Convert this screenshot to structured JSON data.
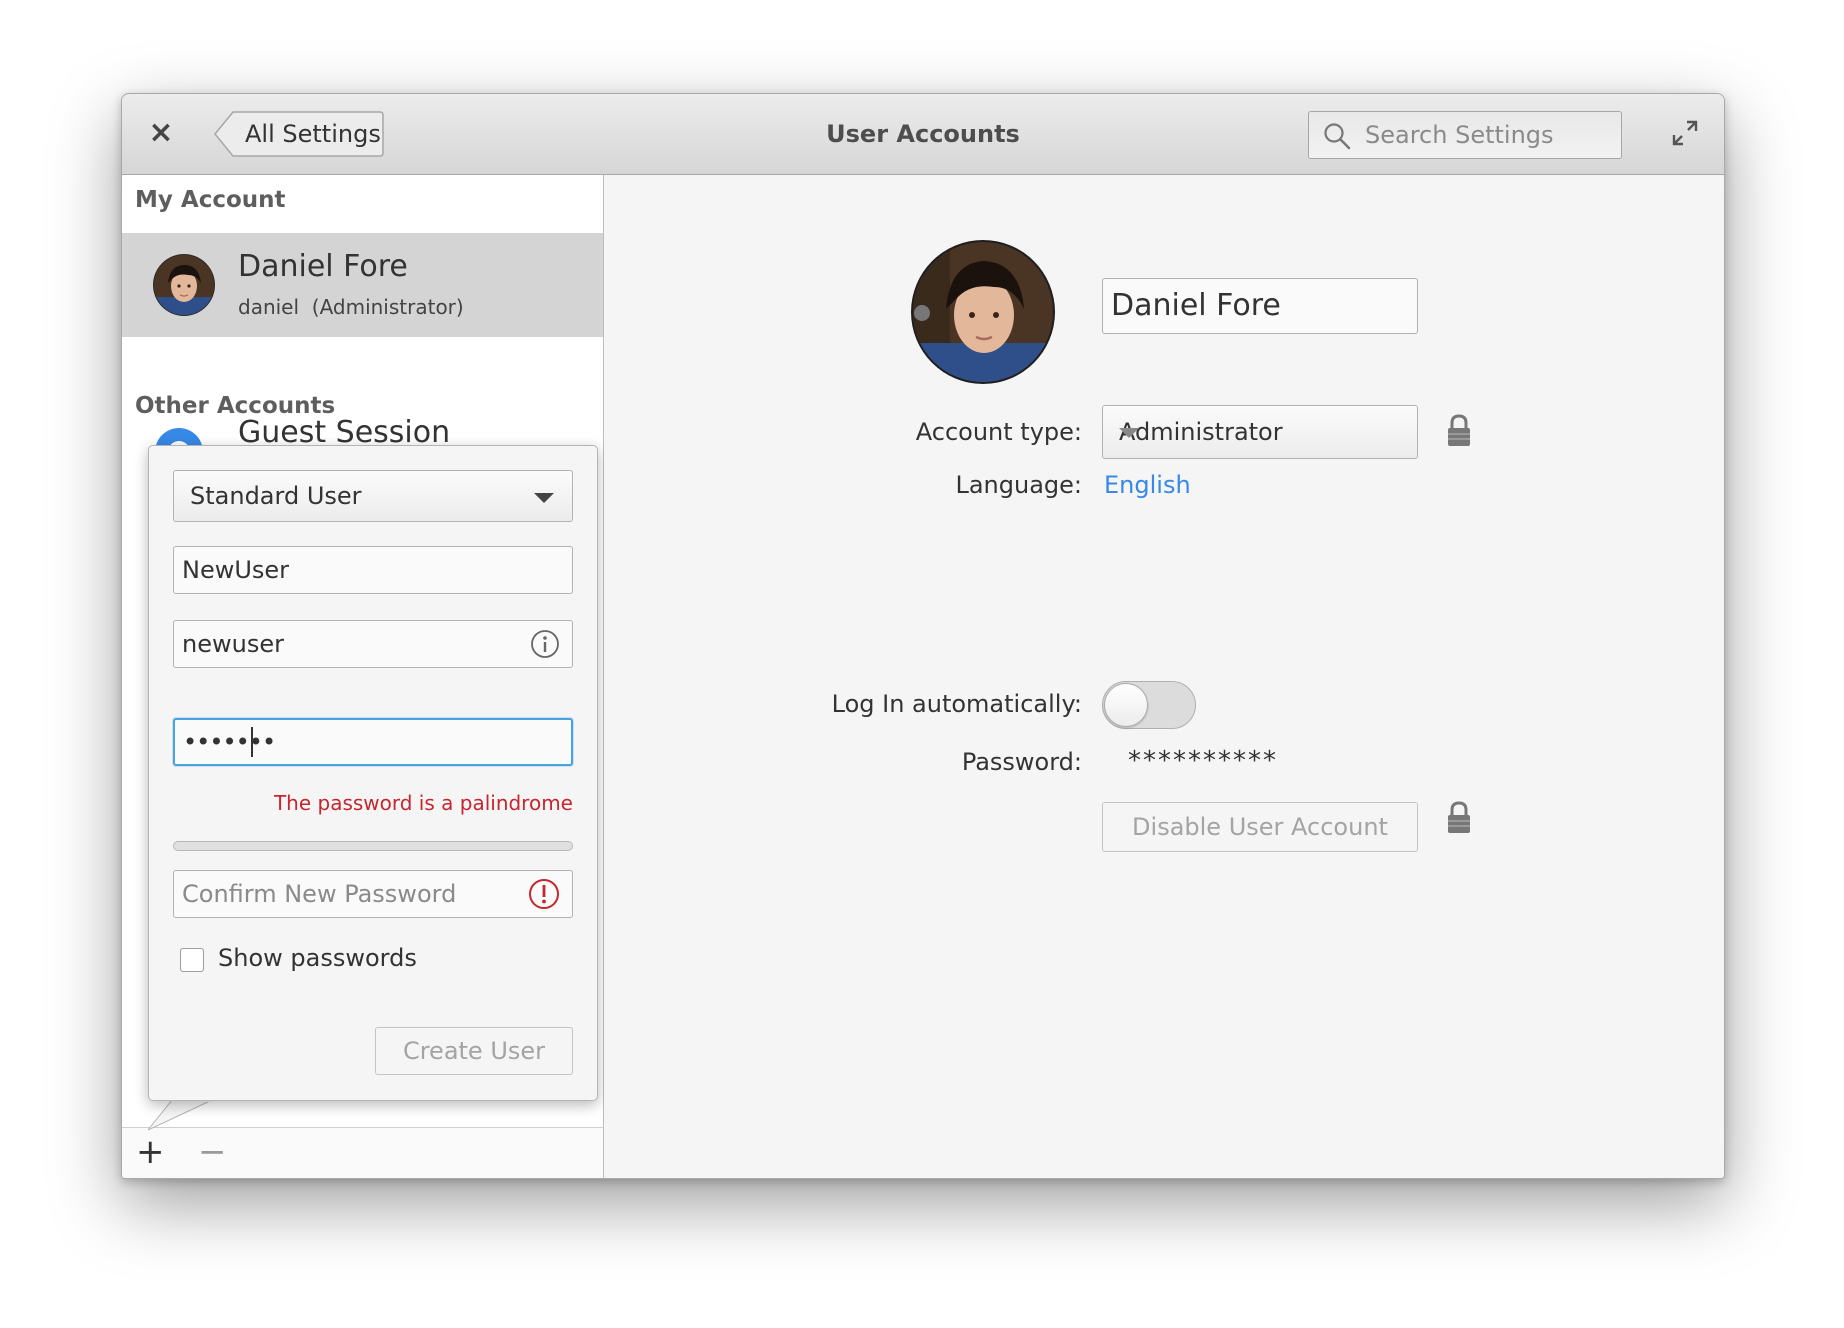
{
  "window": {
    "title": "User Accounts",
    "back_label": "All Settings",
    "search_placeholder": "Search Settings"
  },
  "sidebar": {
    "my_account_header": "My Account",
    "my_account": {
      "name": "Daniel Fore",
      "username": "daniel",
      "role": "(Administrator)"
    },
    "other_accounts_header": "Other Accounts",
    "guest": {
      "name": "Guest Session"
    },
    "footer": {
      "add_label": "+",
      "remove_label": "−"
    }
  },
  "new_user_popover": {
    "account_type": "Standard User",
    "full_name": "NewUser",
    "username": "newuser",
    "password_masked": "•••••••",
    "password_error": "The password is a palindrome",
    "password_strength": 0,
    "confirm_placeholder": "Confirm New Password",
    "show_passwords_label": "Show passwords",
    "show_passwords_checked": false,
    "create_label": "Create User"
  },
  "user_details": {
    "full_name": "Daniel Fore",
    "account_type_label": "Account type:",
    "account_type_value": "Administrator",
    "language_label": "Language:",
    "language_value": "English",
    "autologin_label": "Log In automatically:",
    "autologin_on": false,
    "password_label": "Password:",
    "password_value": "**********",
    "disable_label": "Disable User Account"
  },
  "colors": {
    "accent": "#3689e6",
    "error": "#c6262e",
    "focus": "#4aa3df",
    "guest_icon": "#3689e6"
  },
  "icons": {
    "close": "close-icon",
    "search": "search-icon",
    "maximize": "maximize-icon",
    "info": "info-icon",
    "error": "error-icon",
    "lock": "lock-icon"
  }
}
